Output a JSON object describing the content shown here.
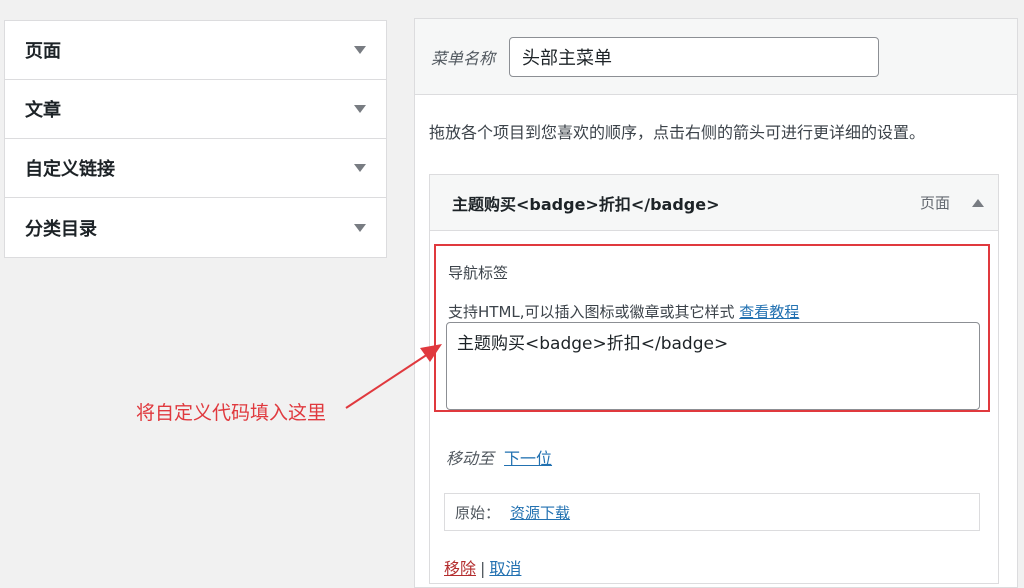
{
  "sidebar": {
    "items": [
      {
        "label": "页面"
      },
      {
        "label": "文章"
      },
      {
        "label": "自定义链接"
      },
      {
        "label": "分类目录"
      }
    ]
  },
  "menu": {
    "name_label": "菜单名称",
    "name_value": "头部主菜单",
    "instructions": "拖放各个项目到您喜欢的顺序，点击右侧的箭头可进行更详细的设置。"
  },
  "item": {
    "title": "主题购买<badge>折扣</badge>",
    "type": "页面",
    "nav_label_title": "导航标签",
    "nav_desc": "支持HTML,可以插入图标或徽章或其它样式",
    "nav_desc_link": "查看教程",
    "nav_value": "主题购买<badge>折扣</badge>",
    "move_label": "移动至",
    "move_link": "下一位",
    "original_label": "原始：",
    "original_link": "资源下载",
    "remove_label": "移除",
    "separator": "|",
    "cancel_label": "取消"
  },
  "annotation": {
    "text": "将自定义代码填入这里",
    "color": "#e0393e"
  }
}
